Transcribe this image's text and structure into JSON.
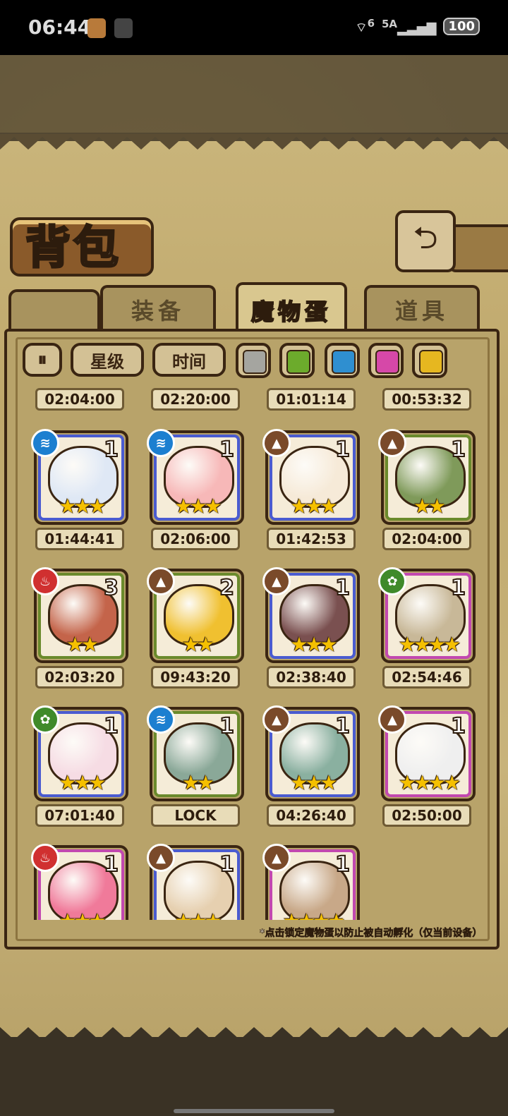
{
  "status_bar": {
    "time": "06:44",
    "wifi": "6",
    "signal": "5A",
    "battery": "100"
  },
  "header": {
    "title": "背包",
    "back_icon": "back-arrow-icon"
  },
  "tabs": [
    {
      "label": "装备",
      "active": false
    },
    {
      "label": "魔物蛋",
      "active": true
    },
    {
      "label": "道具",
      "active": false
    }
  ],
  "filters": {
    "sort_icon": "sort-toggle-icon",
    "star_label": "星级",
    "time_label": "时间",
    "colors": [
      "#a5a5a0",
      "#6cab2c",
      "#2f8fd0",
      "#d648a8",
      "#e6b720"
    ]
  },
  "top_timers": [
    "02:04:00",
    "02:20:00",
    "01:01:14",
    "00:53:32"
  ],
  "eggs": [
    {
      "element": "water",
      "qty": "1",
      "stars": "★★★",
      "rarity": "blue",
      "timer": "01:44:41",
      "art": "cloud-egg"
    },
    {
      "element": "water",
      "qty": "1",
      "stars": "★★★",
      "rarity": "blue",
      "timer": "02:06:00",
      "art": "peach-egg"
    },
    {
      "element": "earth",
      "qty": "1",
      "stars": "★★★",
      "rarity": "blue",
      "timer": "01:42:53",
      "art": "fluffy-egg"
    },
    {
      "element": "earth",
      "qty": "1",
      "stars": "★★",
      "rarity": "green",
      "timer": "02:04:00",
      "art": "sprout-egg"
    },
    {
      "element": "fire",
      "qty": "3",
      "stars": "★★",
      "rarity": "green",
      "timer": "02:03:20",
      "art": "lava-egg"
    },
    {
      "element": "earth",
      "qty": "2",
      "stars": "★★",
      "rarity": "green",
      "timer": "09:43:20",
      "art": "honey-egg"
    },
    {
      "element": "earth",
      "qty": "1",
      "stars": "★★★",
      "rarity": "blue",
      "timer": "02:38:40",
      "art": "book-egg"
    },
    {
      "element": "wood",
      "qty": "1",
      "stars": "★★★★",
      "rarity": "purple",
      "timer": "02:54:46",
      "art": "striped-egg"
    },
    {
      "element": "wood",
      "qty": "1",
      "stars": "★★★",
      "rarity": "blue",
      "timer": "07:01:40",
      "art": "lotus-egg"
    },
    {
      "element": "water",
      "qty": "1",
      "stars": "★★",
      "rarity": "green",
      "timer": "LOCK",
      "art": "shell-egg"
    },
    {
      "element": "earth",
      "qty": "1",
      "stars": "★★★",
      "rarity": "blue",
      "timer": "04:26:40",
      "art": "scarf-egg"
    },
    {
      "element": "earth",
      "qty": "1",
      "stars": "★★★★",
      "rarity": "purple",
      "timer": "02:50:00",
      "art": "feather-egg"
    },
    {
      "element": "fire",
      "qty": "1",
      "stars": "★★★",
      "rarity": "purple",
      "timer": "",
      "art": "crown-egg"
    },
    {
      "element": "earth",
      "qty": "1",
      "stars": "★★★",
      "rarity": "blue",
      "timer": "",
      "art": "fur-egg"
    },
    {
      "element": "earth",
      "qty": "1",
      "stars": "★★★★",
      "rarity": "purple",
      "timer": "",
      "art": "vine-egg"
    }
  ],
  "tip": "*点击锁定魔物蛋以防止被自动孵化（仅当前设备）",
  "colors": {
    "rarity_green": "#6a8a2c",
    "rarity_blue": "#4a5bd0",
    "rarity_purple": "#c248b0",
    "element_water": "#1c7fd0",
    "element_earth": "#7a4a2a",
    "element_fire": "#d03030",
    "element_wood": "#3f8a2a"
  }
}
